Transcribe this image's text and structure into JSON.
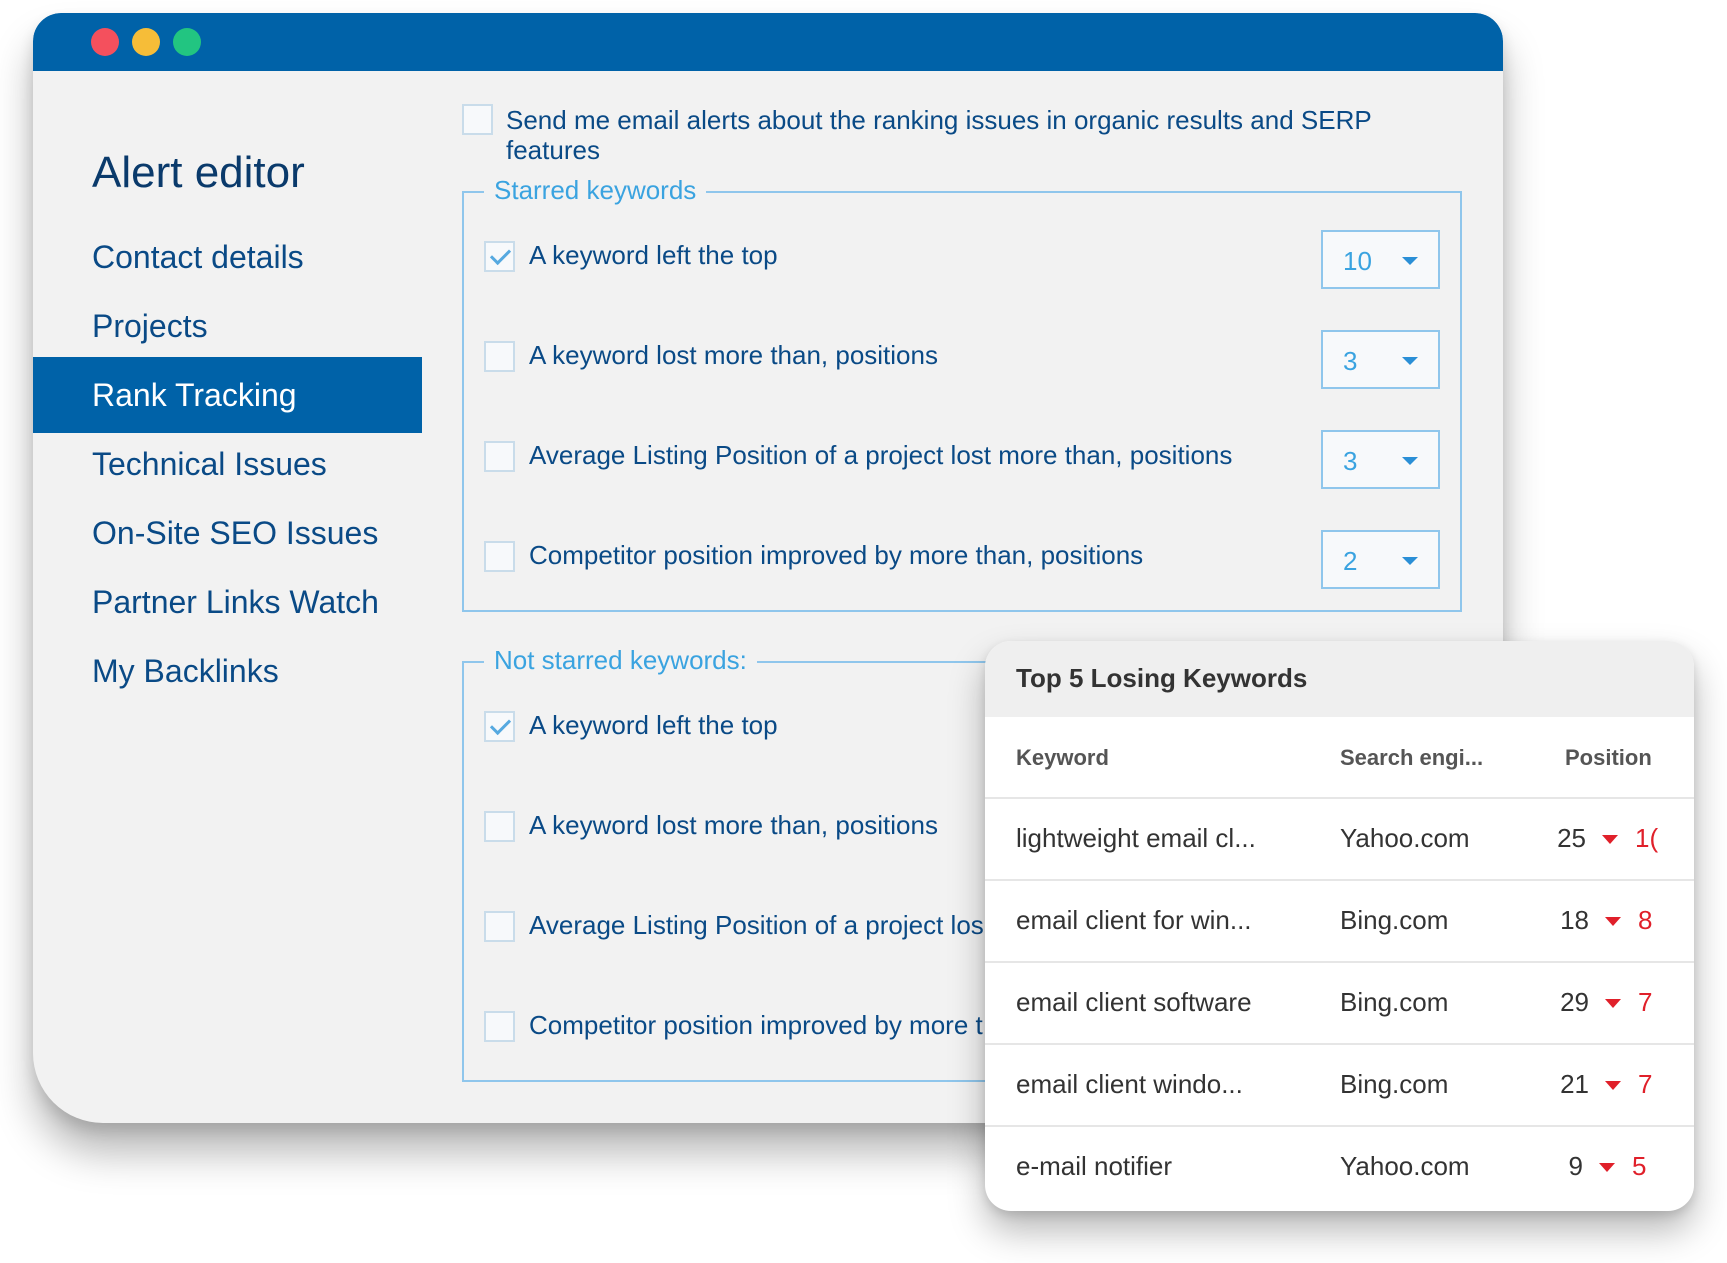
{
  "window": {
    "controls": [
      "close",
      "minimize",
      "maximize"
    ]
  },
  "sidebar": {
    "title": "Alert editor",
    "items": [
      {
        "label": "Contact details",
        "active": false
      },
      {
        "label": "Projects",
        "active": false
      },
      {
        "label": "Rank Tracking",
        "active": true
      },
      {
        "label": "Technical Issues",
        "active": false
      },
      {
        "label": "On-Site SEO Issues",
        "active": false
      },
      {
        "label": "Partner Links Watch",
        "active": false
      },
      {
        "label": "My Backlinks",
        "active": false
      }
    ]
  },
  "email_alert": {
    "label": "Send me email alerts about the ranking issues in organic results and SERP features",
    "checked": false
  },
  "starred": {
    "legend": "Starred keywords",
    "rows": [
      {
        "label": "A keyword left the top",
        "checked": true,
        "value": "10"
      },
      {
        "label": "A keyword lost more than, positions",
        "checked": false,
        "value": "3"
      },
      {
        "label": "Average Listing Position of a project lost more than, positions",
        "checked": false,
        "value": "3"
      },
      {
        "label": "Competitor position improved by more than, positions",
        "checked": false,
        "value": "2"
      }
    ]
  },
  "not_starred": {
    "legend": "Not starred keywords:",
    "rows": [
      {
        "label": "A keyword left the top",
        "checked": true
      },
      {
        "label": "A keyword lost more than, positions",
        "checked": false
      },
      {
        "label": "Average Listing Position of a project los",
        "checked": false
      },
      {
        "label": "Competitor position improved by more t",
        "checked": false
      }
    ]
  },
  "card": {
    "title": "Top 5 Losing Keywords",
    "headers": {
      "keyword": "Keyword",
      "engine": "Search engi...",
      "position": "Position"
    },
    "rows": [
      {
        "keyword": "lightweight email cl...",
        "engine": "Yahoo.com",
        "position": "25",
        "change": "1("
      },
      {
        "keyword": "email client for win...",
        "engine": "Bing.com",
        "position": "18",
        "change": "8"
      },
      {
        "keyword": "email client software",
        "engine": "Bing.com",
        "position": "29",
        "change": "7"
      },
      {
        "keyword": "email client windo...",
        "engine": "Bing.com",
        "position": "21",
        "change": "7"
      },
      {
        "keyword": "e-mail notifier",
        "engine": "Yahoo.com",
        "position": "9",
        "change": "5"
      }
    ],
    "colors": {
      "decrease": "#e0202a"
    }
  },
  "theme": {
    "accent": "#0062a8",
    "text": "#0a4a86",
    "light_accent": "#3aa3e0"
  }
}
